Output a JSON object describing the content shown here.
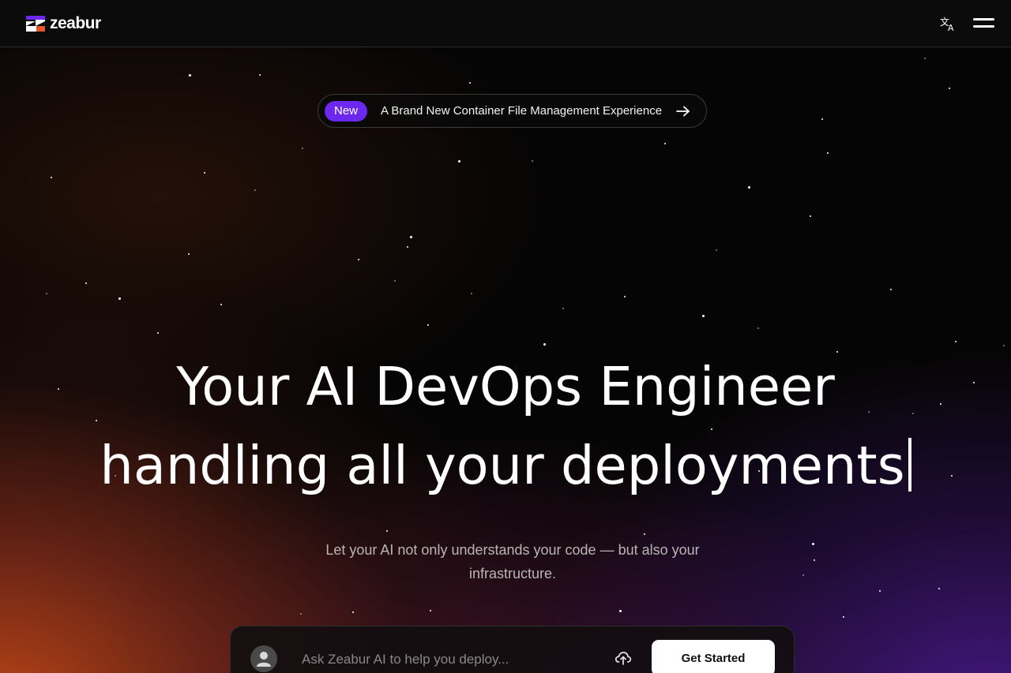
{
  "brand": {
    "name": "zeabur",
    "logo_colors": [
      "#6d28f0",
      "#ffffff",
      "#e4572e"
    ]
  },
  "header": {
    "language_icon": "translate-icon",
    "menu_icon": "hamburger-menu-icon"
  },
  "announcement": {
    "badge": "New",
    "text": "A Brand New Container File Management Experience",
    "arrow_icon": "arrow-right-icon",
    "badge_color": "#6d28f0"
  },
  "hero": {
    "line1": "Your AI DevOps Engineer",
    "line2": "handling all your deployments",
    "subtitle": "Let your AI not only understands your code — but also your infrastructure."
  },
  "prompt": {
    "placeholder": "Ask Zeabur AI to help you deploy...",
    "avatar_icon": "user-avatar-icon",
    "upload_icon": "cloud-upload-icon",
    "cta_label": "Get Started"
  }
}
